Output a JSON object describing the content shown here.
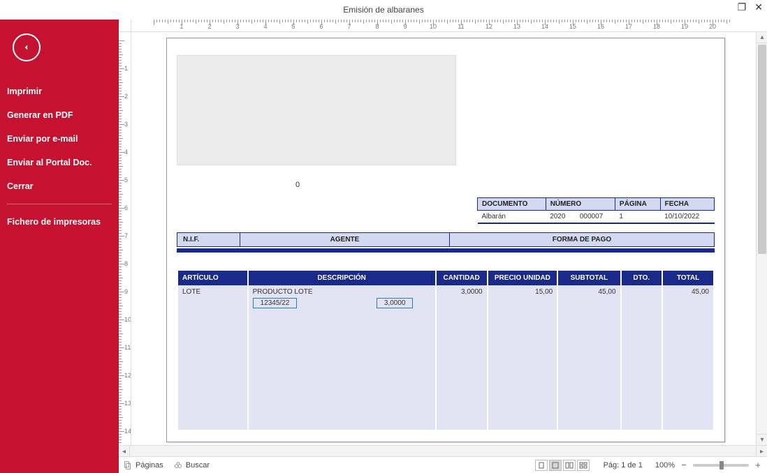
{
  "window": {
    "title": "Emisión de albaranes",
    "maximize_icon": "❐",
    "close_icon": "✕"
  },
  "sidebar": {
    "items": [
      {
        "label": "Imprimir"
      },
      {
        "label": "Generar en PDF"
      },
      {
        "label": "Enviar por e-mail"
      },
      {
        "label": "Enviar al Portal Doc."
      },
      {
        "label": "Cerrar"
      }
    ],
    "after_sep": [
      {
        "label": "Fichero de impresoras"
      }
    ]
  },
  "doc": {
    "zero": "0",
    "info_headers": {
      "documento": "DOCUMENTO",
      "numero": "NÚMERO",
      "pagina": "PÁGINA",
      "fecha": "FECHA"
    },
    "info_values": {
      "documento": "Albarán",
      "serie": "2020",
      "numero": "000007",
      "pagina": "1",
      "fecha": "10/10/2022"
    },
    "nif_headers": {
      "nif": "N.I.F.",
      "agente": "AGENTE",
      "forma": "FORMA DE PAGO"
    },
    "grid_headers": {
      "articulo": "ARTÍCULO",
      "descripcion": "DESCRIPCIÓN",
      "cantidad": "CANTIDAD",
      "precio": "PRECIO UNIDAD",
      "subtotal": "SUBTOTAL",
      "dto": "DTO.",
      "total": "TOTAL"
    },
    "lines": [
      {
        "articulo": "LOTE",
        "descripcion": "PRODUCTO LOTE",
        "lote": "12345/22",
        "lote_qty": "3,0000",
        "cantidad": "3,0000",
        "precio": "15,00",
        "subtotal": "45,00",
        "dto": "",
        "total": "45,00"
      }
    ]
  },
  "status": {
    "paginas": "Páginas",
    "buscar": "Buscar",
    "pag": "Pág: 1 de 1",
    "zoom": "100%"
  },
  "ruler": {
    "hmax": 20,
    "vmax": 14
  }
}
